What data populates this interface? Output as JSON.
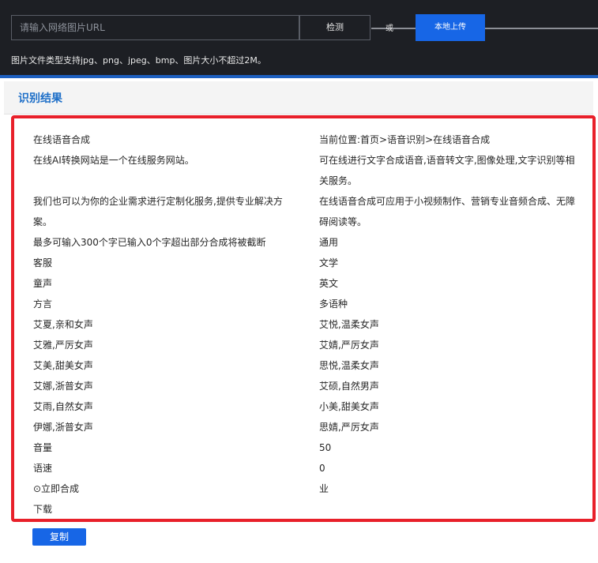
{
  "toolbar": {
    "url_placeholder": "请输入网络图片URL",
    "detect_label": "检测",
    "or_label": "或",
    "upload_label": "本地上传",
    "hint": "图片文件类型支持jpg、png、jpeg、bmp、图片大小不超过2M。"
  },
  "result": {
    "title": "识别结果",
    "left_lines": [
      "在线语音合成",
      "在线AI转换网站是一个在线服务网站。",
      "",
      "我们也可以为你的企业需求进行定制化服务,提供专业解决方",
      "案。",
      "最多可输入300个字已输入0个字超出部分合成将被截断",
      "客服",
      "童声",
      "方言",
      "艾夏,亲和女声",
      "艾雅,严厉女声",
      "艾美,甜美女声",
      "艾娜,浙普女声",
      "艾雨,自然女声",
      "伊娜,浙普女声",
      "音量",
      "语速",
      "⊙立即合成",
      "下载"
    ],
    "right_lines": [
      "当前位置:首页>语音识别>在线语音合成",
      "可在线进行文字合成语音,语音转文字,图像处理,文字识别等相",
      "关服务。",
      "在线语音合成可应用于小视频制作、营销专业音频合成、无障",
      "碍阅读等。",
      "通用",
      "文学",
      "英文",
      "多语种",
      "艾悦,温柔女声",
      "艾婧,严厉女声",
      "思悦,温柔女声",
      "艾硕,自然男声",
      "小美,甜美女声",
      "思婧,严厉女声",
      "50",
      "0",
      "业",
      ""
    ],
    "copy_label": "复制"
  },
  "colors": {
    "banner_bg": "#1d1f24",
    "accent_blue": "#1766e6",
    "highlight_red": "#e8202a",
    "title_blue": "#1e6fc8"
  }
}
